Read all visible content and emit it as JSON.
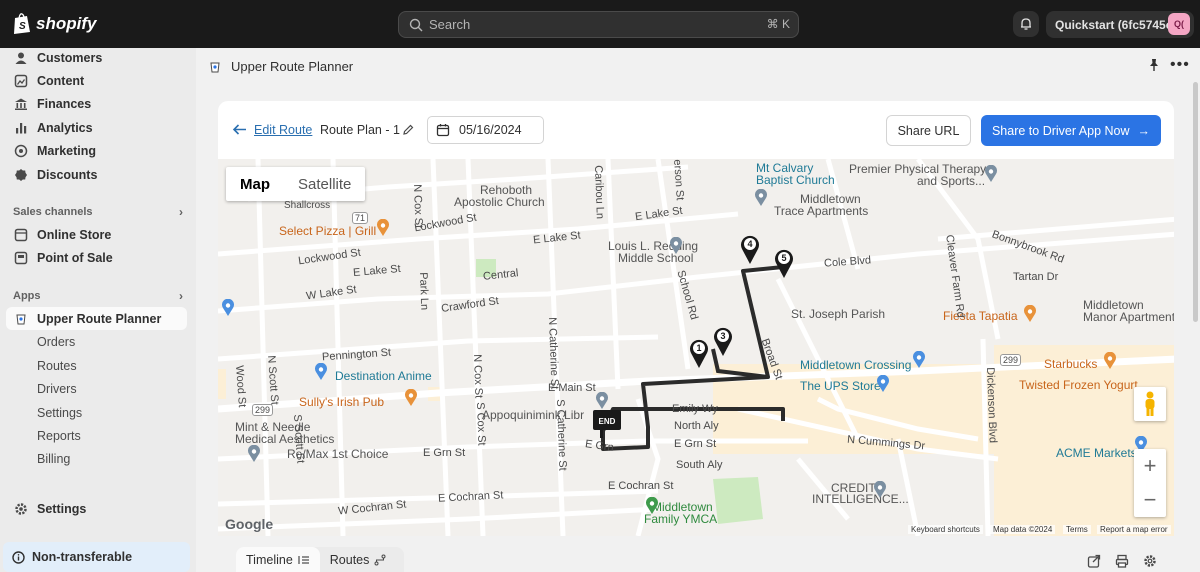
{
  "topbar": {
    "brand": "shopify",
    "search_placeholder": "Search",
    "search_shortcut": "⌘ K",
    "store_name": "Quickstart (6fc5745e)",
    "store_initials": "Q("
  },
  "sidebar": {
    "items": [
      {
        "label": "Customers",
        "icon": "person-icon"
      },
      {
        "label": "Content",
        "icon": "content-icon"
      },
      {
        "label": "Finances",
        "icon": "bank-icon"
      },
      {
        "label": "Analytics",
        "icon": "chart-icon"
      },
      {
        "label": "Marketing",
        "icon": "target-icon"
      },
      {
        "label": "Discounts",
        "icon": "discount-icon"
      }
    ],
    "sales_channels_label": "Sales channels",
    "channels": [
      {
        "label": "Online Store",
        "icon": "store-icon"
      },
      {
        "label": "Point of Sale",
        "icon": "pos-icon"
      }
    ],
    "apps_label": "Apps",
    "app": {
      "label": "Upper Route Planner",
      "icon": "app-icon"
    },
    "app_subitems": [
      "Orders",
      "Routes",
      "Drivers",
      "Settings",
      "Reports",
      "Billing"
    ],
    "settings_label": "Settings",
    "nontransferable_label": "Non-transferable"
  },
  "header": {
    "app_title": "Upper Route Planner"
  },
  "toolbar": {
    "edit_route": "Edit Route",
    "plan_name": "Route Plan - 1",
    "date": "05/16/2024",
    "share_url": "Share URL",
    "share_driver": "Share to Driver App Now",
    "share_driver_arrow": "→"
  },
  "map": {
    "type_map": "Map",
    "type_satellite": "Satellite",
    "stops": [
      "1",
      "3",
      "4",
      "5"
    ],
    "end_label": "END",
    "labels": {
      "mt_calvary": "Mt Calvary",
      "baptist": "Baptist Church",
      "premier": "Premier Physical Therapy",
      "sports": "and Sports...",
      "middletown_trace": "Middletown",
      "trace_apts": "Trace Apartments",
      "rehoboth": "Rehoboth",
      "apostolic": "Apostolic Church",
      "shallcross": "Shallcross",
      "select_pizza": "Select Pizza | Grill",
      "louis": "Louis L. Redding",
      "middle_school": "Middle School",
      "lockwood": "Lockwood St",
      "lockwood2": "Lockwood St",
      "e_lake": "E Lake St",
      "e_lake2": "E Lake St",
      "e_lake3": "E Lake St",
      "w_lake": "W Lake St",
      "central": "Central",
      "crawford": "Crawford St",
      "cole_blvd": "Cole Blvd",
      "bonnybrook": "Bonnybrook Rd",
      "tartan": "Tartan Dr",
      "st_joseph": "St. Joseph Parish",
      "fiesta": "Fiesta Tapatia",
      "middletown_manor": "Middletown",
      "manor_apts": "Manor Apartment",
      "pennington": "Pennington St",
      "destination": "Destination Anime",
      "sullys": "Sully's Irish Pub",
      "middletown_crossing": "Middletown Crossing",
      "ups": "The UPS Store",
      "starbucks": "Starbucks",
      "twisted": "Twisted Frozen Yogurt",
      "e_main": "E Main St",
      "appo": "Appoquinimink Libr",
      "emily": "Emily Wy",
      "north_aly": "North Aly",
      "e_grn": "E Grn St",
      "e_grn2": "E Grn St",
      "e_grn3": "E Grn",
      "south_aly": "South Aly",
      "n_cummings": "N Cummings Dr",
      "acme": "ACME Markets",
      "mint": "Mint & Needle",
      "medical": "Medical Aesthetics",
      "remax": "Re/Max 1st Choice",
      "e_cochran": "E Cochran St",
      "e_cochran2": "E Cochran St",
      "w_cochran": "W Cochran St",
      "credit": "CREDIT",
      "intelligence": "INTELLIGENCE...",
      "ymca1": "Middletown",
      "ymca2": "Family YMCA",
      "n_cox": "N Cox St",
      "n_cox2": "N Cox St",
      "s_cox": "S Cox St",
      "park_ln": "Park Ln",
      "n_catherine": "N Catherine St",
      "s_catherine": "S Catherine St",
      "caribou": "Caribou Ln",
      "school_rd": "School Rd",
      "cleaver": "Cleaver Farm Rd",
      "dickenson": "Dickenson Blvd",
      "wood_st": "Wood St",
      "n_scott": "N Scott St",
      "s_scott": "S Scott St",
      "broad": "Broad St",
      "erson": "erson St",
      "r71": "71",
      "r299a": "299",
      "r299b": "299",
      "google": "Google",
      "kbd": "Keyboard shortcuts",
      "mapdata": "Map data ©2024",
      "terms": "Terms",
      "report": "Report a map error"
    }
  },
  "bottom": {
    "timeline": "Timeline",
    "routes": "Routes"
  },
  "colors": {
    "primary": "#2b74e4",
    "link": "#2a6fb0",
    "route": "#2b2b2b"
  }
}
